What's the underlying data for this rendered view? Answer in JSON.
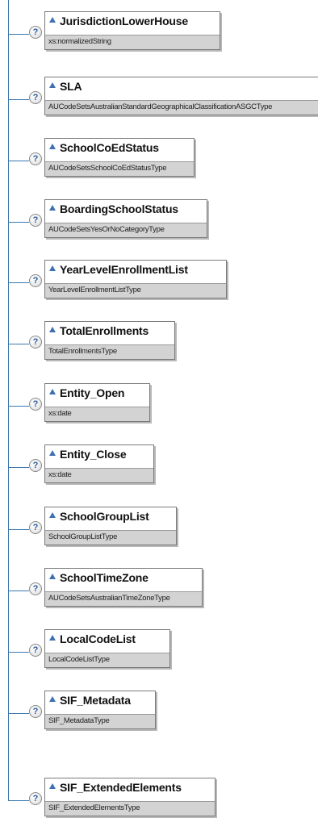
{
  "diagram": {
    "help_symbol": "?",
    "elements": [
      {
        "name": "JurisdictionLowerHouse",
        "type": "xs:normalizedString"
      },
      {
        "name": "SLA",
        "type": "AUCodeSetsAustralianStandardGeographicalClassificationASGCType"
      },
      {
        "name": "SchoolCoEdStatus",
        "type": "AUCodeSetsSchoolCoEdStatusType"
      },
      {
        "name": "BoardingSchoolStatus",
        "type": "AUCodeSetsYesOrNoCategoryType"
      },
      {
        "name": "YearLevelEnrollmentList",
        "type": "YearLevelEnrollmentListType"
      },
      {
        "name": "TotalEnrollments",
        "type": "TotalEnrollmentsType"
      },
      {
        "name": "Entity_Open",
        "type": "xs:date"
      },
      {
        "name": "Entity_Close",
        "type": "xs:date"
      },
      {
        "name": "SchoolGroupList",
        "type": "SchoolGroupListType"
      },
      {
        "name": "SchoolTimeZone",
        "type": "AUCodeSetsAustralianTimeZoneType"
      },
      {
        "name": "LocalCodeList",
        "type": "LocalCodeListType"
      },
      {
        "name": "SIF_Metadata",
        "type": "SIF_MetadataType"
      },
      {
        "name": "SIF_ExtendedElements",
        "type": "SIF_ExtendedElementsType"
      }
    ]
  }
}
